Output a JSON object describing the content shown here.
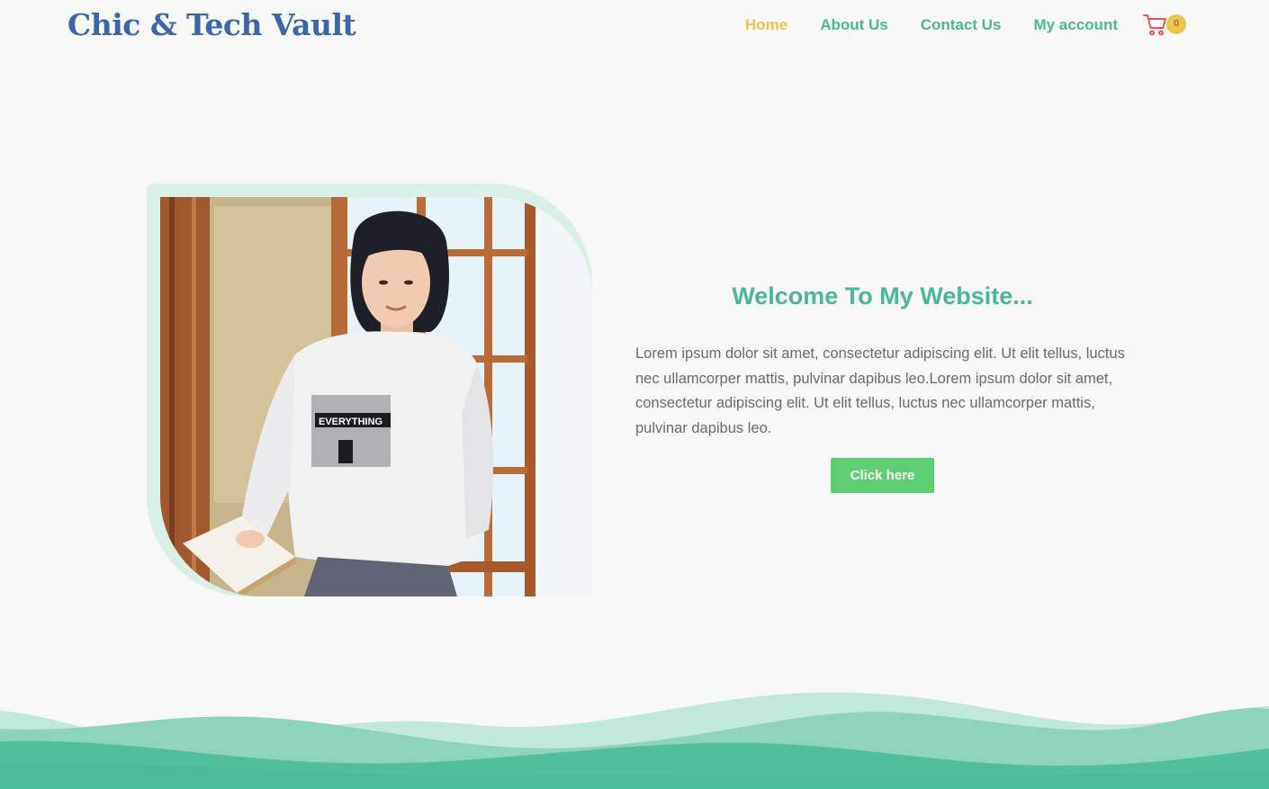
{
  "header": {
    "logo": "Chic & Tech Vault",
    "nav": [
      {
        "label": "Home",
        "active": true
      },
      {
        "label": "About Us",
        "active": false
      },
      {
        "label": "Contact Us",
        "active": false
      },
      {
        "label": "My account",
        "active": false
      }
    ],
    "cart": {
      "icon": "cart-icon",
      "count": "0"
    }
  },
  "hero": {
    "image_alt": "Woman in white sweatshirt sitting by a window",
    "heading": "Welcome To My Website...",
    "paragraph": "Lorem ipsum dolor sit amet, consectetur adipiscing elit. Ut elit tellus, luctus nec ullamcorper mattis, pulvinar dapibus leo.Lorem ipsum dolor sit amet, consectetur adipiscing elit. Ut elit tellus, luctus nec ullamcorper mattis, pulvinar dapibus leo.",
    "button": "Click here"
  },
  "colors": {
    "brand_blue": "#3b67a8",
    "accent_green": "#4ab897",
    "active_yellow": "#f1c24c",
    "button_green": "#5fce72",
    "cart_red": "#e8545a"
  }
}
